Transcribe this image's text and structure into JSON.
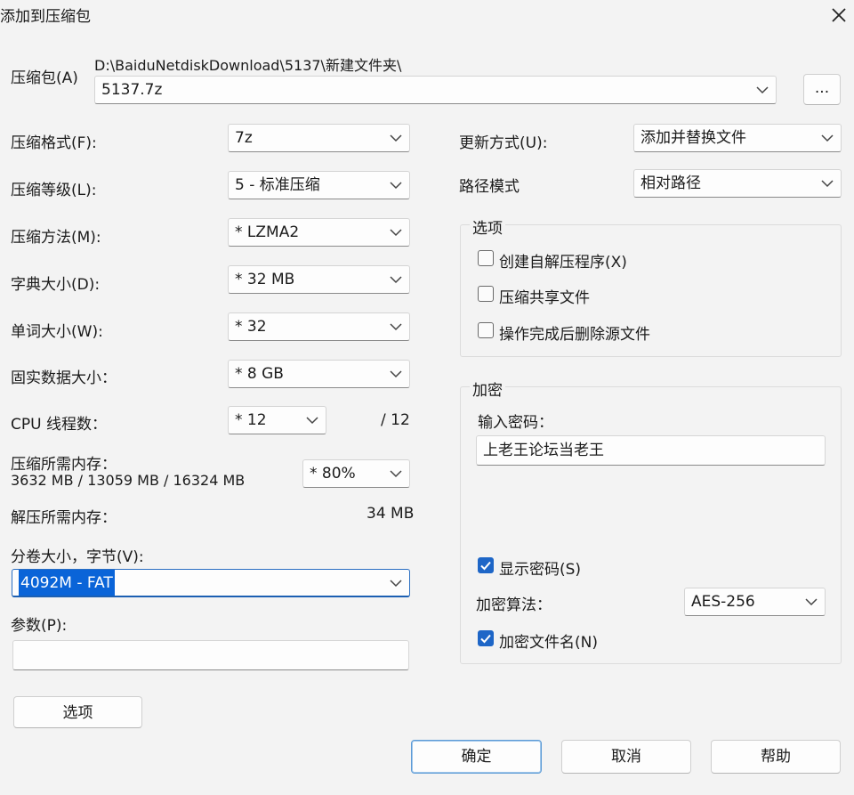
{
  "window": {
    "title": "添加到压缩包",
    "close_icon": "close-icon"
  },
  "archive": {
    "label": "压缩包(A)",
    "path": "D:\\BaiduNetdiskDownload\\5137\\新建文件夹\\",
    "name": "5137.7z",
    "browse_label": "..."
  },
  "left": {
    "format": {
      "label": "压缩格式(F):",
      "value": "7z"
    },
    "level": {
      "label": "压缩等级(L):",
      "value": "5 - 标准压缩"
    },
    "method": {
      "label": "压缩方法(M):",
      "value": "*  LZMA2"
    },
    "dict": {
      "label": "字典大小(D):",
      "value": "*  32 MB"
    },
    "word": {
      "label": "单词大小(W):",
      "value": "*  32"
    },
    "solid": {
      "label": "固实数据大小：",
      "value": "*  8 GB"
    },
    "cpu": {
      "label": "CPU 线程数：",
      "value": "*  12",
      "total": "/ 12"
    },
    "mem_compress": {
      "label": "压缩所需内存：",
      "detail": "3632 MB / 13059 MB / 16324 MB",
      "value": "*  80%"
    },
    "mem_decompress": {
      "label": "解压所需内存：",
      "value": "34 MB"
    },
    "volume": {
      "label": "分卷大小，字节(V):",
      "value": "4092M - FAT"
    },
    "params": {
      "label": "参数(P):",
      "value": ""
    },
    "options_button": "选项"
  },
  "right": {
    "update": {
      "label": "更新方式(U):",
      "value": "添加并替换文件"
    },
    "path_mode": {
      "label": "路径模式",
      "value": "相对路径"
    },
    "options": {
      "title": "选项",
      "sfx": {
        "label": "创建自解压程序(X)",
        "checked": false
      },
      "shared": {
        "label": "压缩共享文件",
        "checked": false
      },
      "delete": {
        "label": "操作完成后删除源文件",
        "checked": false
      }
    },
    "encryption": {
      "title": "加密",
      "password_label": "输入密码：",
      "password": "上老王论坛当老王",
      "show_password": {
        "label": "显示密码(S)",
        "checked": true
      },
      "method_label": "加密算法：",
      "method": "AES-256",
      "encrypt_names": {
        "label": "加密文件名(N)",
        "checked": true
      }
    }
  },
  "footer": {
    "ok": "确定",
    "cancel": "取消",
    "help": "帮助"
  },
  "colors": {
    "accent": "#1e66c7",
    "background": "#f3f3f3",
    "selection": "#0a64d8"
  }
}
